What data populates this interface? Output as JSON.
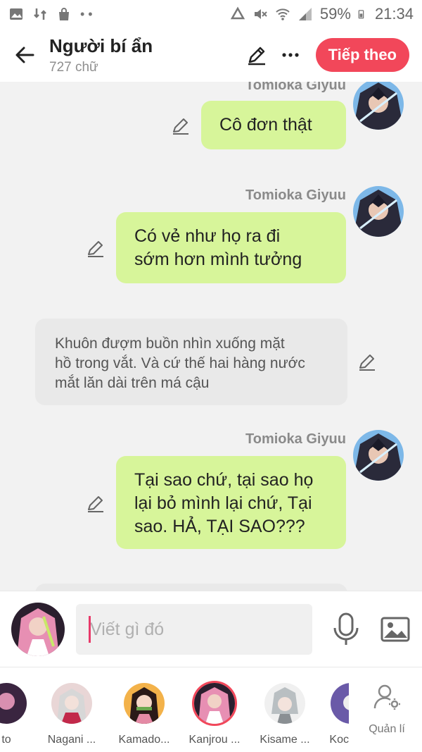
{
  "statusbar": {
    "battery": "59%",
    "time": "21:34"
  },
  "header": {
    "title": "Người bí ẩn",
    "subtitle": "727 chữ",
    "next_label": "Tiếp theo"
  },
  "messages": [
    {
      "type": "me",
      "sender": "Tomioka Giyuu",
      "lines": [
        "Cô đơn thật"
      ]
    },
    {
      "type": "me",
      "sender": "Tomioka Giyuu",
      "lines": [
        "Có vẻ như họ ra đi",
        "sớm hơn mình tưởng"
      ]
    },
    {
      "type": "narration",
      "lines": [
        "Khuôn đượm buồn nhìn xuống mặt",
        "hồ trong vắt. Và cứ thế hai hàng nước",
        "mắt lăn dài trên má cậu"
      ]
    },
    {
      "type": "me",
      "sender": "Tomioka Giyuu",
      "lines": [
        "Tại sao chứ, tại sao họ",
        "lại bỏ mình lại chứ, Tại",
        "sao. HẢ, TẠI SAO???"
      ]
    }
  ],
  "composer": {
    "placeholder": "Viết gì đó"
  },
  "characters": [
    {
      "name": "to"
    },
    {
      "name": "Nagani ..."
    },
    {
      "name": "Kamado..."
    },
    {
      "name": "Kanjrou ..."
    },
    {
      "name": "Kisame ..."
    },
    {
      "name": "Koc"
    }
  ],
  "manage_label": "Quản lí",
  "colors": {
    "accent": "#f2475a",
    "my_bubble": "#d7f59a",
    "narration_bubble": "#e9e9e9"
  }
}
